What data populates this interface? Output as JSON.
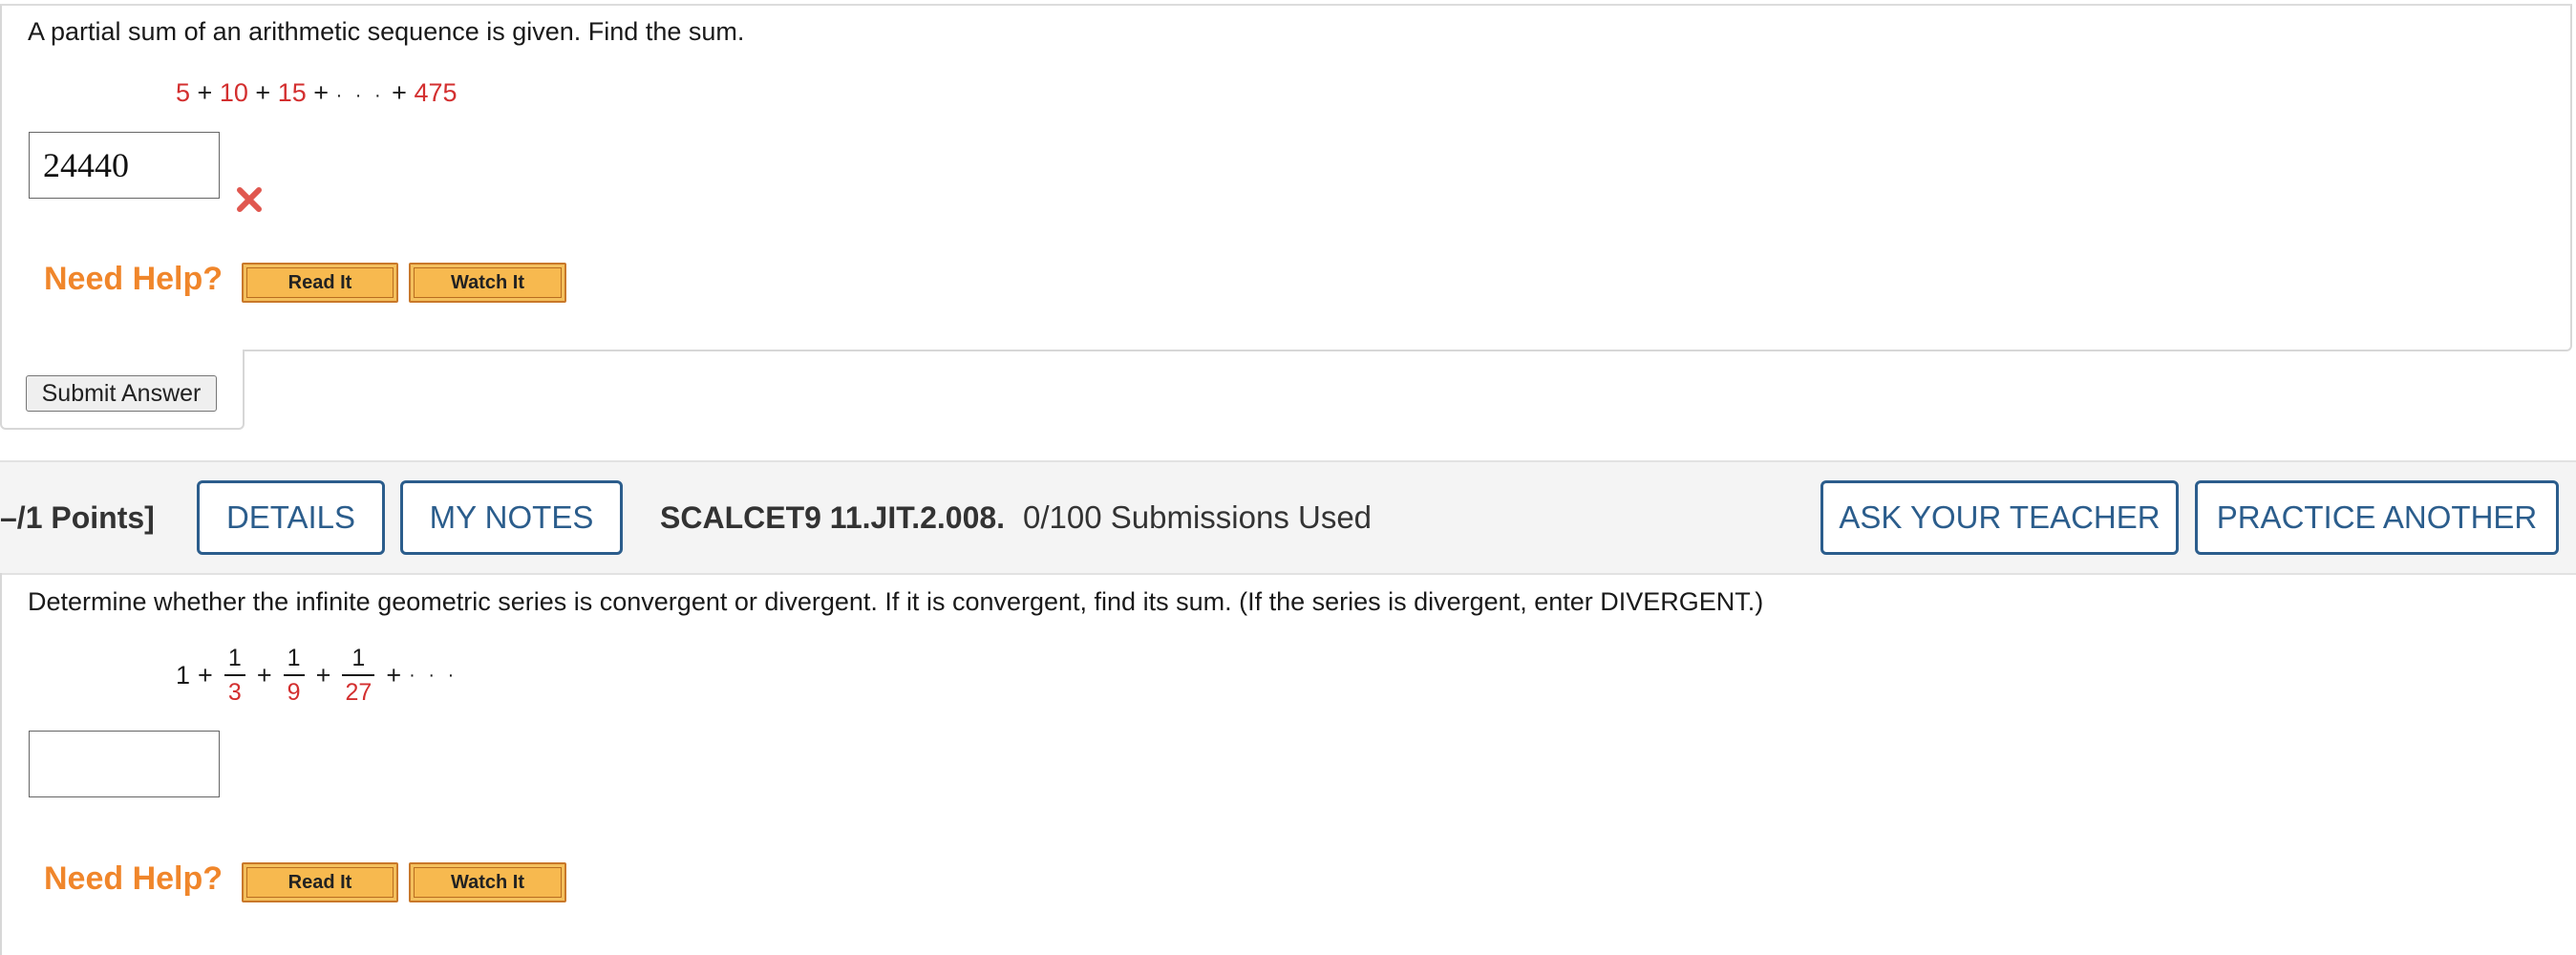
{
  "question1": {
    "prompt": "A partial sum of an arithmetic sequence is given. Find the sum.",
    "sequence": {
      "t1": "5",
      "t2": "10",
      "t3": "15",
      "last": "475",
      "plus": "+",
      "ellipsis": "· · ·"
    },
    "answer_value": "24440",
    "status": "incorrect",
    "need_help_label": "Need Help?",
    "read_it_label": "Read It",
    "watch_it_label": "Watch It",
    "submit_label": "Submit Answer"
  },
  "question2_header": {
    "points_label": "–/1 Points]",
    "details_label": "DETAILS",
    "my_notes_label": "MY NOTES",
    "question_code": "SCALCET9 11.JIT.2.008.",
    "submissions_used": "0/100 Submissions Used",
    "ask_teacher_label": "ASK YOUR TEACHER",
    "practice_another_label": "PRACTICE ANOTHER"
  },
  "question2": {
    "prompt": "Determine whether the infinite geometric series is convergent or divergent. If it is convergent, find its sum. (If the series is divergent, enter DIVERGENT.)",
    "series": {
      "first": "1",
      "plus": "+",
      "fractions": [
        {
          "num": "1",
          "den": "3"
        },
        {
          "num": "1",
          "den": "9"
        },
        {
          "num": "1",
          "den": "27"
        }
      ],
      "ellipsis": "· · ·"
    },
    "answer_value": "",
    "need_help_label": "Need Help?",
    "read_it_label": "Read It",
    "watch_it_label": "Watch It"
  },
  "colors": {
    "accent_blue": "#2b5d8c",
    "help_orange": "#f0862b",
    "term_red": "#d32f2f",
    "error_x": "#e0574f",
    "header_bg": "#f4f4f4"
  },
  "icons": {
    "incorrect": "close-x-icon"
  }
}
